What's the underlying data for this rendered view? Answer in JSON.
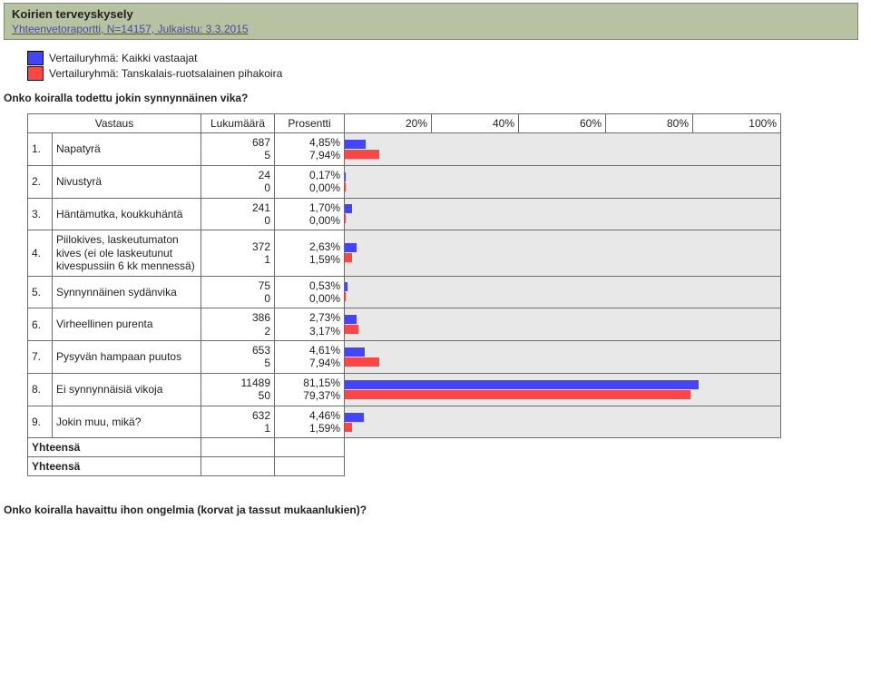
{
  "header": {
    "title": "Koirien terveyskysely",
    "subtitle": "Yhteenvetoraportti, N=14157, Julkaistu: 3.3.2015"
  },
  "legend": {
    "group1": {
      "label": "Vertailuryhmä: Kaikki vastaajat",
      "color": "#4444ff"
    },
    "group2": {
      "label": "Vertailuryhmä: Tanskalais-ruotsalainen pihakoira",
      "color": "#ff4444"
    }
  },
  "question1": "Onko koiralla todettu jokin synnynnäinen vika?",
  "columns": {
    "vastaus": "Vastaus",
    "lukumaara": "Lukumäärä",
    "prosentti": "Prosentti"
  },
  "ticks": [
    "20%",
    "40%",
    "60%",
    "80%",
    "100%"
  ],
  "rows": [
    {
      "idx": "1.",
      "label": "Napatyrä",
      "count1": "687",
      "pct1": "4,85%",
      "p1": 4.85,
      "count2": "5",
      "pct2": "7,94%",
      "p2": 7.94
    },
    {
      "idx": "2.",
      "label": "Nivustyrä",
      "count1": "24",
      "pct1": "0,17%",
      "p1": 0.17,
      "count2": "0",
      "pct2": "0,00%",
      "p2": 0.0
    },
    {
      "idx": "3.",
      "label": "Häntämutka, koukkuhäntä",
      "count1": "241",
      "pct1": "1,70%",
      "p1": 1.7,
      "count2": "0",
      "pct2": "0,00%",
      "p2": 0.0
    },
    {
      "idx": "4.",
      "label": "Piilokives, laskeutumaton kives (ei ole laskeutunut kivespussiin 6 kk mennessä)",
      "count1": "372",
      "pct1": "2,63%",
      "p1": 2.63,
      "count2": "1",
      "pct2": "1,59%",
      "p2": 1.59
    },
    {
      "idx": "5.",
      "label": "Synnynnäinen sydänvika",
      "count1": "75",
      "pct1": "0,53%",
      "p1": 0.53,
      "count2": "0",
      "pct2": "0,00%",
      "p2": 0.0
    },
    {
      "idx": "6.",
      "label": "Virheellinen purenta",
      "count1": "386",
      "pct1": "2,73%",
      "p1": 2.73,
      "count2": "2",
      "pct2": "3,17%",
      "p2": 3.17
    },
    {
      "idx": "7.",
      "label": "Pysyvän hampaan puutos",
      "count1": "653",
      "pct1": "4,61%",
      "p1": 4.61,
      "count2": "5",
      "pct2": "7,94%",
      "p2": 7.94
    },
    {
      "idx": "8.",
      "label": "Ei synnynnäisiä vikoja",
      "count1": "11489",
      "pct1": "81,15%",
      "p1": 81.15,
      "count2": "50",
      "pct2": "79,37%",
      "p2": 79.37
    },
    {
      "idx": "9.",
      "label": "Jokin muu, mikä?",
      "count1": "632",
      "pct1": "4,46%",
      "p1": 4.46,
      "count2": "1",
      "pct2": "1,59%",
      "p2": 1.59
    }
  ],
  "totals_label": "Yhteensä",
  "question2": "Onko koiralla havaittu ihon ongelmia (korvat ja tassut mukaanlukien)?",
  "chart_data": {
    "type": "bar",
    "title": "Onko koiralla todettu jokin synnynnäinen vika?",
    "xlabel": "Prosentti",
    "ylabel": "Vastaus",
    "xlim": [
      0,
      100
    ],
    "categories": [
      "Napatyrä",
      "Nivustyrä",
      "Häntämutka, koukkuhäntä",
      "Piilokives, laskeutumaton kives (ei ole laskeutunut kivespussiin 6 kk mennessä)",
      "Synnynnäinen sydänvika",
      "Virheellinen purenta",
      "Pysyvän hampaan puutos",
      "Ei synnynnäisiä vikoja",
      "Jokin muu, mikä?"
    ],
    "series": [
      {
        "name": "Kaikki vastaajat",
        "color": "#4444ff",
        "values": [
          4.85,
          0.17,
          1.7,
          2.63,
          0.53,
          2.73,
          4.61,
          81.15,
          4.46
        ],
        "counts": [
          687,
          24,
          241,
          372,
          75,
          386,
          653,
          11489,
          632
        ]
      },
      {
        "name": "Tanskalais-ruotsalainen pihakoira",
        "color": "#ff4444",
        "values": [
          7.94,
          0.0,
          0.0,
          1.59,
          0.0,
          3.17,
          7.94,
          79.37,
          1.59
        ],
        "counts": [
          5,
          0,
          0,
          1,
          0,
          2,
          5,
          50,
          1
        ]
      }
    ]
  }
}
